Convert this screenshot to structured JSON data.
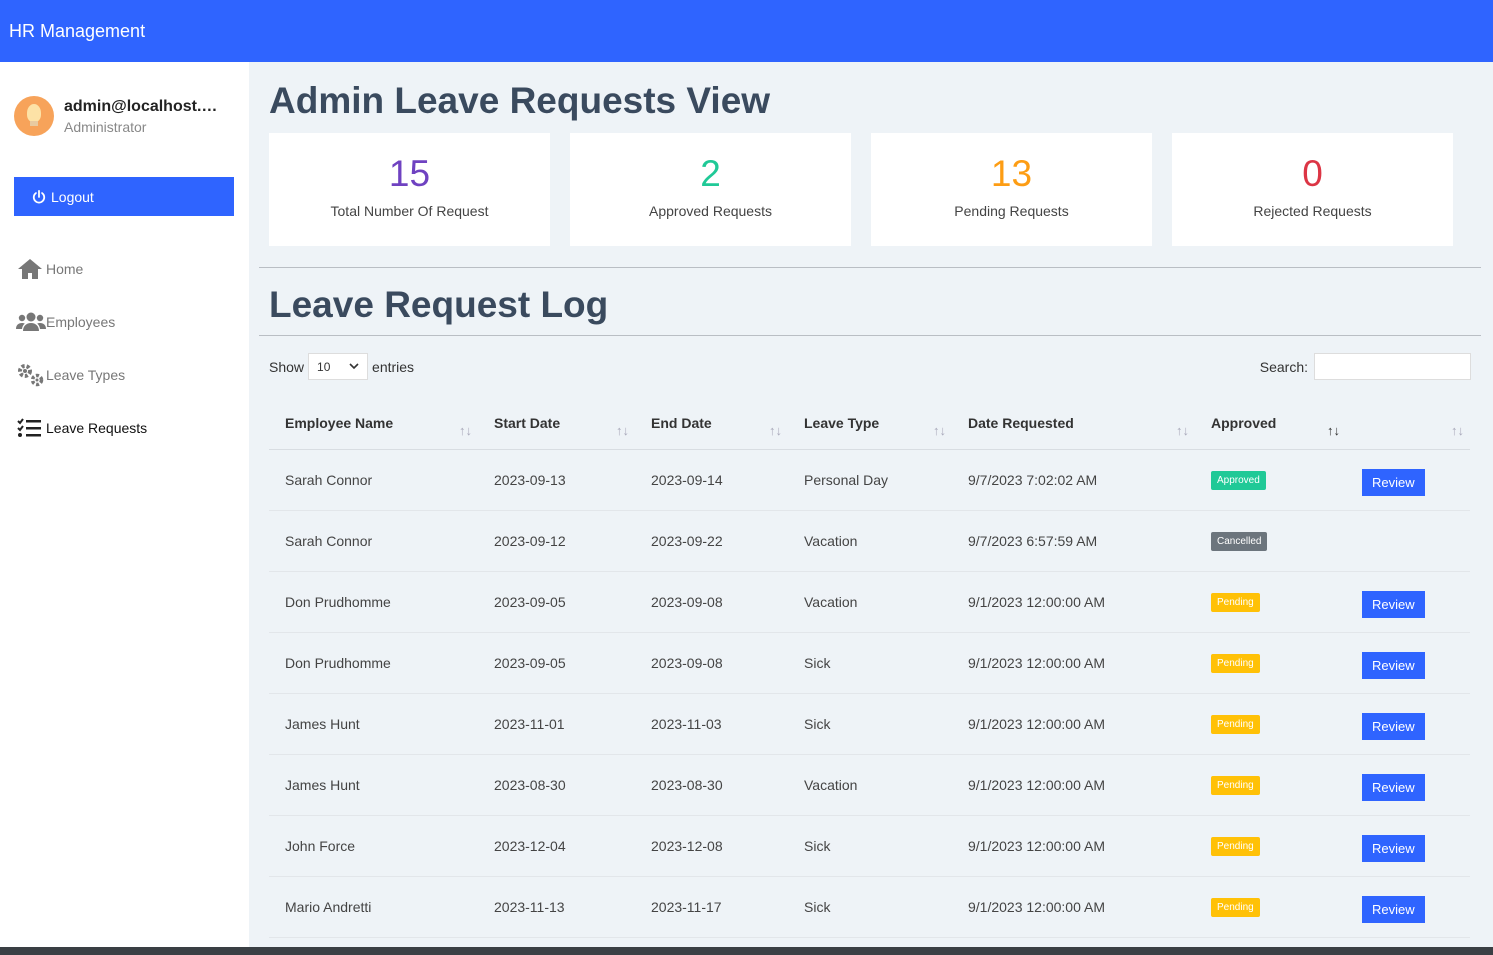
{
  "app": {
    "title": "HR Management"
  },
  "user": {
    "email": "admin@localhost.com",
    "role": "Administrator"
  },
  "sidebar": {
    "logout_label": "Logout",
    "items": [
      {
        "label": "Home",
        "icon": "home-icon"
      },
      {
        "label": "Employees",
        "icon": "users-icon"
      },
      {
        "label": "Leave Types",
        "icon": "gears-icon"
      },
      {
        "label": "Leave Requests",
        "icon": "list-check-icon"
      }
    ]
  },
  "page": {
    "title": "Admin Leave Requests View",
    "log_title": "Leave Request Log"
  },
  "stats": [
    {
      "value": "15",
      "label": "Total Number Of Request",
      "color": "#6f42c1"
    },
    {
      "value": "2",
      "label": "Approved Requests",
      "color": "#20c997"
    },
    {
      "value": "13",
      "label": "Pending Requests",
      "color": "#fd9d14"
    },
    {
      "value": "0",
      "label": "Rejected Requests",
      "color": "#dc3545"
    }
  ],
  "table_controls": {
    "show_label": "Show",
    "entries_value": "10",
    "entries_label": "entries",
    "search_label": "Search:"
  },
  "table": {
    "headers": [
      "Employee Name",
      "Start Date",
      "End Date",
      "Leave Type",
      "Date Requested",
      "Approved",
      ""
    ],
    "rows": [
      {
        "name": "Sarah Connor",
        "start": "2023-09-13",
        "end": "2023-09-14",
        "type": "Personal Day",
        "requested": "9/7/2023 7:02:02 AM",
        "status": "Approved",
        "action": "Review"
      },
      {
        "name": "Sarah Connor",
        "start": "2023-09-12",
        "end": "2023-09-22",
        "type": "Vacation",
        "requested": "9/7/2023 6:57:59 AM",
        "status": "Cancelled",
        "action": ""
      },
      {
        "name": "Don Prudhomme",
        "start": "2023-09-05",
        "end": "2023-09-08",
        "type": "Vacation",
        "requested": "9/1/2023 12:00:00 AM",
        "status": "Pending",
        "action": "Review"
      },
      {
        "name": "Don Prudhomme",
        "start": "2023-09-05",
        "end": "2023-09-08",
        "type": "Sick",
        "requested": "9/1/2023 12:00:00 AM",
        "status": "Pending",
        "action": "Review"
      },
      {
        "name": "James Hunt",
        "start": "2023-11-01",
        "end": "2023-11-03",
        "type": "Sick",
        "requested": "9/1/2023 12:00:00 AM",
        "status": "Pending",
        "action": "Review"
      },
      {
        "name": "James Hunt",
        "start": "2023-08-30",
        "end": "2023-08-30",
        "type": "Vacation",
        "requested": "9/1/2023 12:00:00 AM",
        "status": "Pending",
        "action": "Review"
      },
      {
        "name": "John Force",
        "start": "2023-12-04",
        "end": "2023-12-08",
        "type": "Sick",
        "requested": "9/1/2023 12:00:00 AM",
        "status": "Pending",
        "action": "Review"
      },
      {
        "name": "Mario Andretti",
        "start": "2023-11-13",
        "end": "2023-11-17",
        "type": "Sick",
        "requested": "9/1/2023 12:00:00 AM",
        "status": "Pending",
        "action": "Review"
      }
    ]
  }
}
